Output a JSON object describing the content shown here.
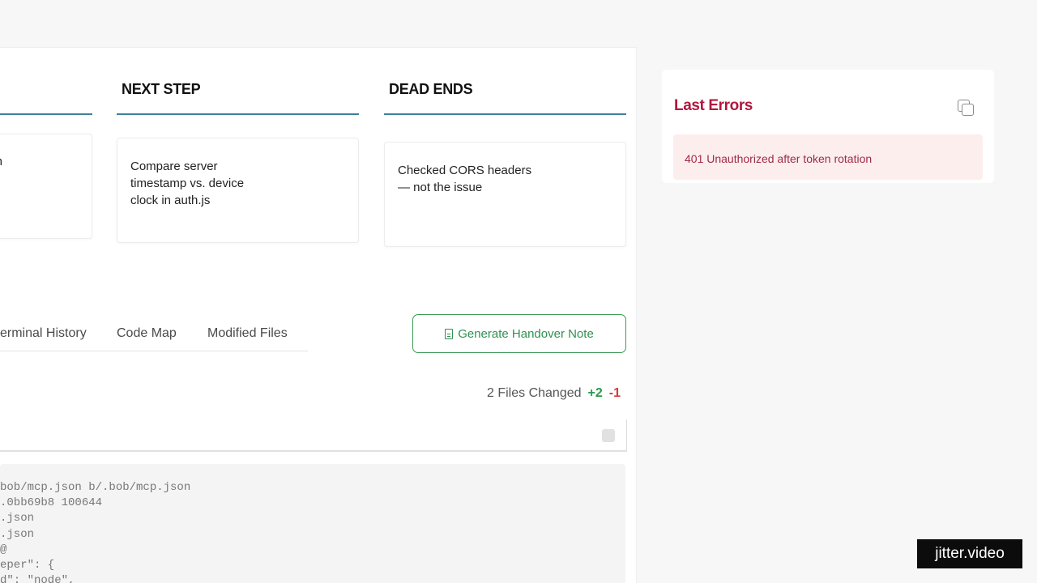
{
  "columns": {
    "next_step": {
      "header": "NEXT STEP",
      "card_text": "Compare server\ntimestamp vs. device\nclock in auth.js"
    },
    "dead_ends": {
      "header": "DEAD ENDS",
      "card_text": "Checked CORS headers\n— not the issue"
    },
    "left_partial": {
      "card_text": "n"
    }
  },
  "tabs": [
    {
      "label": "erminal History"
    },
    {
      "label": "Code Map"
    },
    {
      "label": "Modified Files"
    }
  ],
  "handover_button": {
    "label": "Generate Handover Note",
    "icon": "document-icon"
  },
  "files_summary": {
    "label": "2 Files Changed",
    "additions": "+2",
    "deletions": "-1"
  },
  "diff_lines": [
    "bob/mcp.json b/.bob/mcp.json",
    ".0bb69b8 100644",
    ".json",
    ".json",
    "@",
    "eper\": {",
    "d\": \"node\","
  ],
  "errors_panel": {
    "title": "Last Errors",
    "copy_icon": "copy-icon",
    "items": [
      {
        "text": "401 Unauthorized after token rotation"
      }
    ]
  },
  "watermark": "jitter.video",
  "colors": {
    "accent_rule": "#3f7f98",
    "success": "#2f9150",
    "danger": "#d63b3b",
    "error_title": "#b2163d",
    "error_bg": "#fdeeee"
  }
}
